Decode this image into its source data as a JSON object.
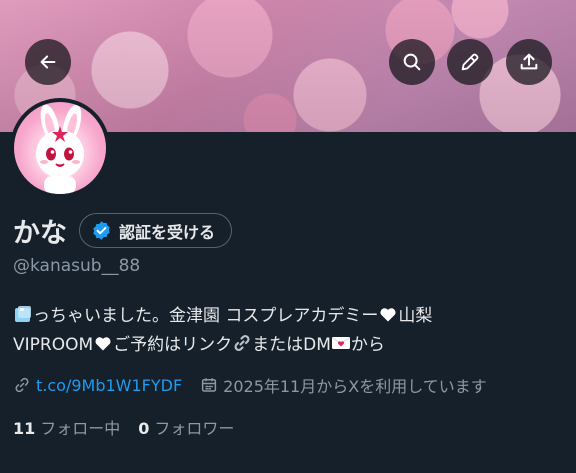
{
  "header": {
    "back_icon": "arrow-left-icon",
    "search_icon": "search-icon",
    "edit_icon": "pencil-icon",
    "share_icon": "share-upload-icon"
  },
  "profile": {
    "name": "かな",
    "verify_label": "認証を受ける",
    "handle": "@kanasub__88",
    "bio_line1": "っちゃいました。金津園 コスプレアカデミー",
    "bio_line1_end": "山梨",
    "bio_line2_a": "VIPROOM",
    "bio_line2_b": "ご予約はリンク",
    "bio_line2_c": "またはDM",
    "bio_line2_d": "から",
    "link_text": "t.co/9Mb1W1FYDF",
    "joined_text": "2025年11月からXを利用しています",
    "following_count": "11",
    "following_label": "フォロー中",
    "followers_count": "0",
    "followers_label": "フォロワー"
  },
  "colors": {
    "background": "#15202b",
    "link": "#1d9bf0",
    "verified_badge": "#1d9bf0",
    "muted_text": "#8b98a5"
  }
}
